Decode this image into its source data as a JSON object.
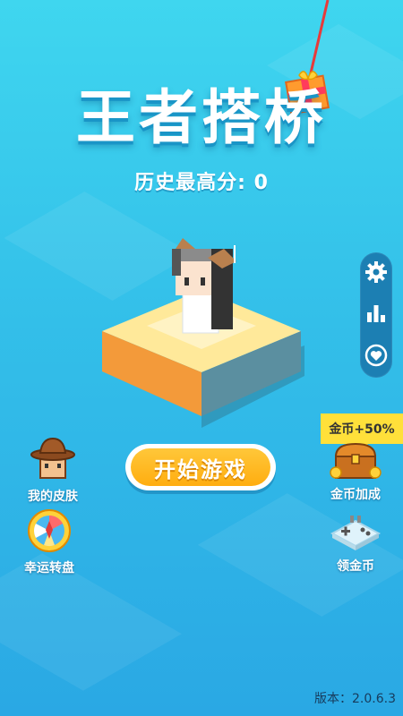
{
  "game": {
    "title": "王者搭桥",
    "best_score_label": "历史最高分:",
    "best_score": "0",
    "start_button": "开始游戏",
    "version": "版本：2.0.6.3"
  },
  "side_menu": [
    {
      "icon": "gear-icon"
    },
    {
      "icon": "leaderboard-icon"
    },
    {
      "icon": "heart-icon"
    }
  ],
  "left_menu": [
    {
      "label": "我的皮肤",
      "icon": "skin-hat-icon"
    },
    {
      "label": "幸运转盘",
      "icon": "lucky-wheel-icon"
    }
  ],
  "right_menu": [
    {
      "label": "金币加成",
      "icon": "treasure-chest-icon",
      "tag": "金币+50%"
    },
    {
      "label": "领金币",
      "icon": "gamepad-icon"
    }
  ],
  "colors": {
    "bg_top": "#3fd6ef",
    "bg_bottom": "#2aa8e4",
    "start_button": "#ffad10",
    "side_panel": "#1c7fb3",
    "bonus_tag": "#ffe03a"
  }
}
